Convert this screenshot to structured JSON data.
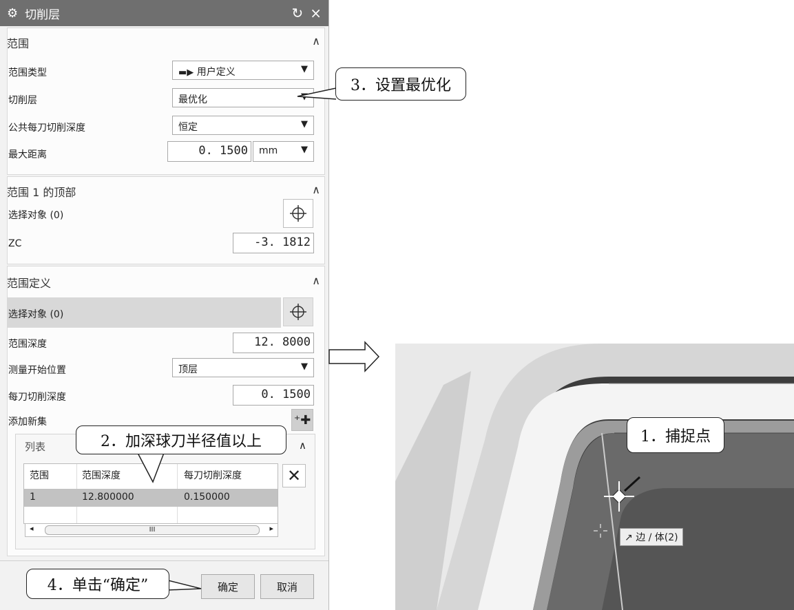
{
  "dialog": {
    "title": "切削层",
    "title_icon": "gear-icon",
    "reset_glyph": "↻",
    "close_glyph": "×"
  },
  "range_section": {
    "header": "范围",
    "range_type_label": "范围类型",
    "range_type_value": "用户定义",
    "cut_level_label": "切削层",
    "cut_level_value": "最优化",
    "common_depth_label": "公共每刀切削深度",
    "common_depth_value": "恒定",
    "max_distance_label": "最大距离",
    "max_distance_value": "0. 1500",
    "max_distance_unit": "mm"
  },
  "range1_top": {
    "header": "范围 1 的顶部",
    "select_label": "选择对象 (0)",
    "zc_label": "ZC",
    "zc_value": "-3. 1812"
  },
  "range_def": {
    "header": "范围定义",
    "select_label": "选择对象 (0)",
    "depth_label": "范围深度",
    "depth_value": "12. 8000",
    "measure_label": "测量开始位置",
    "measure_value": "顶层",
    "per_cut_label": "每刀切削深度",
    "per_cut_value": "0. 1500",
    "add_set_label": "添加新集"
  },
  "list": {
    "header": "列表",
    "columns": [
      "范围",
      "范围深度",
      "每刀切削深度"
    ],
    "rows": [
      [
        "1",
        "12.800000",
        "0.150000"
      ]
    ],
    "scroll_mark": "III"
  },
  "buttons": {
    "ok": "确定",
    "cancel": "取消"
  },
  "callouts": {
    "c1": "1．捕捉点",
    "c2": "2．加深球刀半径值以上",
    "c3": "3．设置最优化",
    "c4": "4．单击“确定”"
  },
  "viewport": {
    "tag": "边 / 体(2)"
  },
  "colors": {
    "titlebar": "#6f6f6f",
    "selected_row": "#c2c2c2",
    "panel": "#f2f2f2"
  }
}
